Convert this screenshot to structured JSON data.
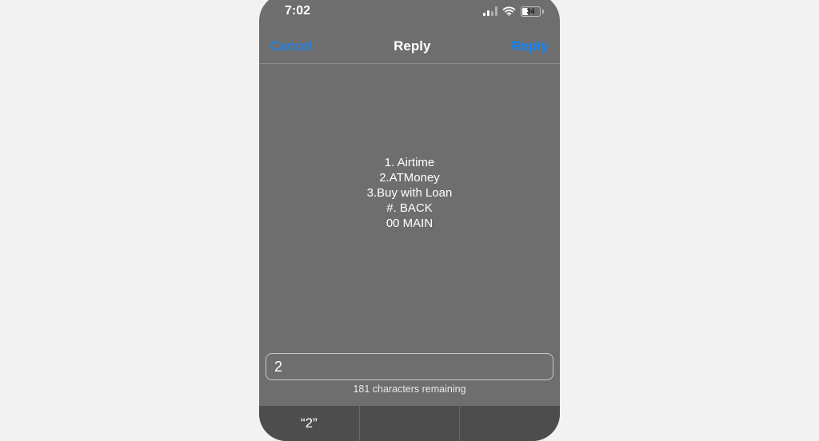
{
  "status": {
    "time": "7:02",
    "battery_text": "34",
    "battery_pct": 34
  },
  "nav": {
    "cancel": "Cancel",
    "title": "Reply",
    "reply": "Reply"
  },
  "menu": {
    "lines": [
      "1. Airtime",
      "2.ATMoney",
      "3.Buy with Loan",
      "#. BACK",
      "00 MAIN"
    ]
  },
  "input": {
    "value": "2",
    "remaining": "181 characters remaining"
  },
  "suggestions": [
    "“2”",
    "",
    ""
  ],
  "colors": {
    "accent": "#0a84ff",
    "bg": "#6e6e6e"
  }
}
